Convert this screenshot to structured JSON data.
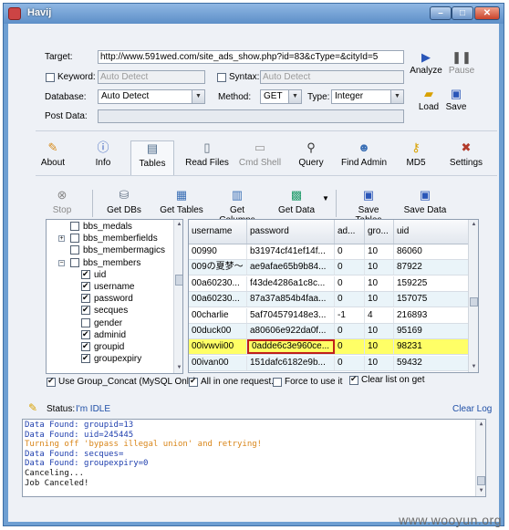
{
  "window": {
    "title": "Havij"
  },
  "form": {
    "target_label": "Target:",
    "target_value": "http://www.591wed.com/site_ads_show.php?id=83&cType=&cityId=5",
    "keyword_label": "Keyword:",
    "keyword_placeholder": "Auto Detect",
    "syntax_label": "Syntax:",
    "syntax_placeholder": "Auto Detect",
    "database_label": "Database:",
    "database_value": "Auto Detect",
    "method_label": "Method:",
    "method_value": "GET",
    "type_label": "Type:",
    "type_value": "Integer",
    "postdata_label": "Post Data:"
  },
  "side_actions": {
    "analyze": "Analyze",
    "pause": "Pause",
    "load": "Load",
    "save": "Save"
  },
  "tabs": [
    "About",
    "Info",
    "Tables",
    "Read Files",
    "Cmd Shell",
    "Query",
    "Find Admin",
    "MD5",
    "Settings"
  ],
  "toolbar": {
    "stop": "Stop",
    "get_dbs": "Get DBs",
    "get_tables": "Get Tables",
    "get_columns": "Get Columns",
    "get_data": "Get Data",
    "save_tables": "Save Tables",
    "save_data": "Save Data"
  },
  "tree": [
    {
      "label": "bbs_medals",
      "checked": false,
      "level": 1,
      "expander": ""
    },
    {
      "label": "bbs_memberfields",
      "checked": false,
      "level": 1,
      "expander": "+"
    },
    {
      "label": "bbs_membermagics",
      "checked": false,
      "level": 1,
      "expander": ""
    },
    {
      "label": "bbs_members",
      "checked": false,
      "level": 1,
      "expander": "−"
    },
    {
      "label": "uid",
      "checked": true,
      "level": 2,
      "expander": ""
    },
    {
      "label": "username",
      "checked": true,
      "level": 2,
      "expander": ""
    },
    {
      "label": "password",
      "checked": true,
      "level": 2,
      "expander": ""
    },
    {
      "label": "secques",
      "checked": true,
      "level": 2,
      "expander": ""
    },
    {
      "label": "gender",
      "checked": false,
      "level": 2,
      "expander": ""
    },
    {
      "label": "adminid",
      "checked": true,
      "level": 2,
      "expander": ""
    },
    {
      "label": "groupid",
      "checked": true,
      "level": 2,
      "expander": ""
    },
    {
      "label": "groupexpiry",
      "checked": true,
      "level": 2,
      "expander": ""
    }
  ],
  "grid": {
    "columns": [
      "username",
      "password",
      "ad...",
      "gro...",
      "uid"
    ],
    "rows": [
      [
        "00990",
        "b31974cf41ef14f...",
        "0",
        "10",
        "86060"
      ],
      [
        "009の夏梦～",
        "ae9afae65b9b84...",
        "0",
        "10",
        "87922"
      ],
      [
        "00a60230...",
        "f43de4286a1c8c...",
        "0",
        "10",
        "159225"
      ],
      [
        "00a60230...",
        "87a37a854b4faa...",
        "0",
        "10",
        "157075"
      ],
      [
        "00charlie",
        "5af704579148e3...",
        "-1",
        "4",
        "216893"
      ],
      [
        "00duck00",
        "a80606e922da0f...",
        "0",
        "10",
        "95169"
      ],
      [
        "00ivwvii00",
        "0adde6c3e960ce...",
        "0",
        "10",
        "98231"
      ],
      [
        "00ivan00",
        "151dafc6182e9b...",
        "0",
        "10",
        "59432"
      ]
    ],
    "selected_row": 6
  },
  "options": {
    "use_group_concat": "Use Group_Concat (MySQL Only)",
    "all_in_one": "All in one request.",
    "force_to_use": "Force to use it",
    "clear_list": "Clear list on get"
  },
  "status": {
    "label": "Status:",
    "value": "I'm IDLE",
    "clear_log": "Clear Log"
  },
  "log": [
    {
      "text": "Data Found: groupid=13",
      "color": "#1f3fae"
    },
    {
      "text": "Data Found: uid=245445",
      "color": "#1f3fae"
    },
    {
      "text": "Turning off 'bypass illegal union' and retrying!",
      "color": "#d9861a"
    },
    {
      "text": "Data Found: secques=",
      "color": "#1f3fae"
    },
    {
      "text": "Data Found: groupexpiry=0",
      "color": "#1f3fae"
    },
    {
      "text": "Canceling...",
      "color": "#111111"
    },
    {
      "text": "Job Canceled!",
      "color": "#111111"
    }
  ],
  "watermark": "www.wooyun.org",
  "colors": {
    "selected_row": "#ffff66",
    "selected_cell_border": "#c0201b",
    "row_alt": "#eaf4f9"
  }
}
